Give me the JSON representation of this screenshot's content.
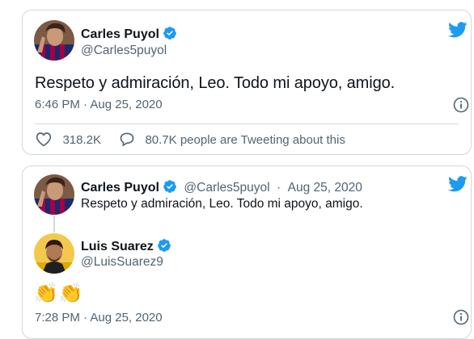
{
  "tweet1": {
    "author_name": "Carles Puyol",
    "author_handle": "@Carles5puyol",
    "text": "Respeto y admiración, Leo. Todo mi apoyo, amigo.",
    "timestamp": "6:46 PM · Aug 25, 2020",
    "likes": "318.2K",
    "tweeting_about": "80.7K people are Tweeting about this",
    "icons": [
      "twitter-bird-icon",
      "verified-badge-icon",
      "info-icon",
      "heart-icon",
      "speech-bubble-icon"
    ]
  },
  "tweet2": {
    "quoted": {
      "author_name": "Carles Puyol",
      "author_handle": "@Carles5puyol",
      "separator": "·",
      "date": "Aug 25, 2020",
      "text": "Respeto y admiración, Leo. Todo mi apoyo, amigo."
    },
    "reply": {
      "author_name": "Luis Suarez",
      "author_handle": "@LuisSuarez9",
      "text": "👏👏",
      "timestamp": "7:28 PM · Aug 25, 2020"
    }
  },
  "colors": {
    "twitter_blue": "#1d9bf0",
    "text_primary": "#0f1419",
    "text_secondary": "#536471",
    "border": "#cfd9de"
  }
}
